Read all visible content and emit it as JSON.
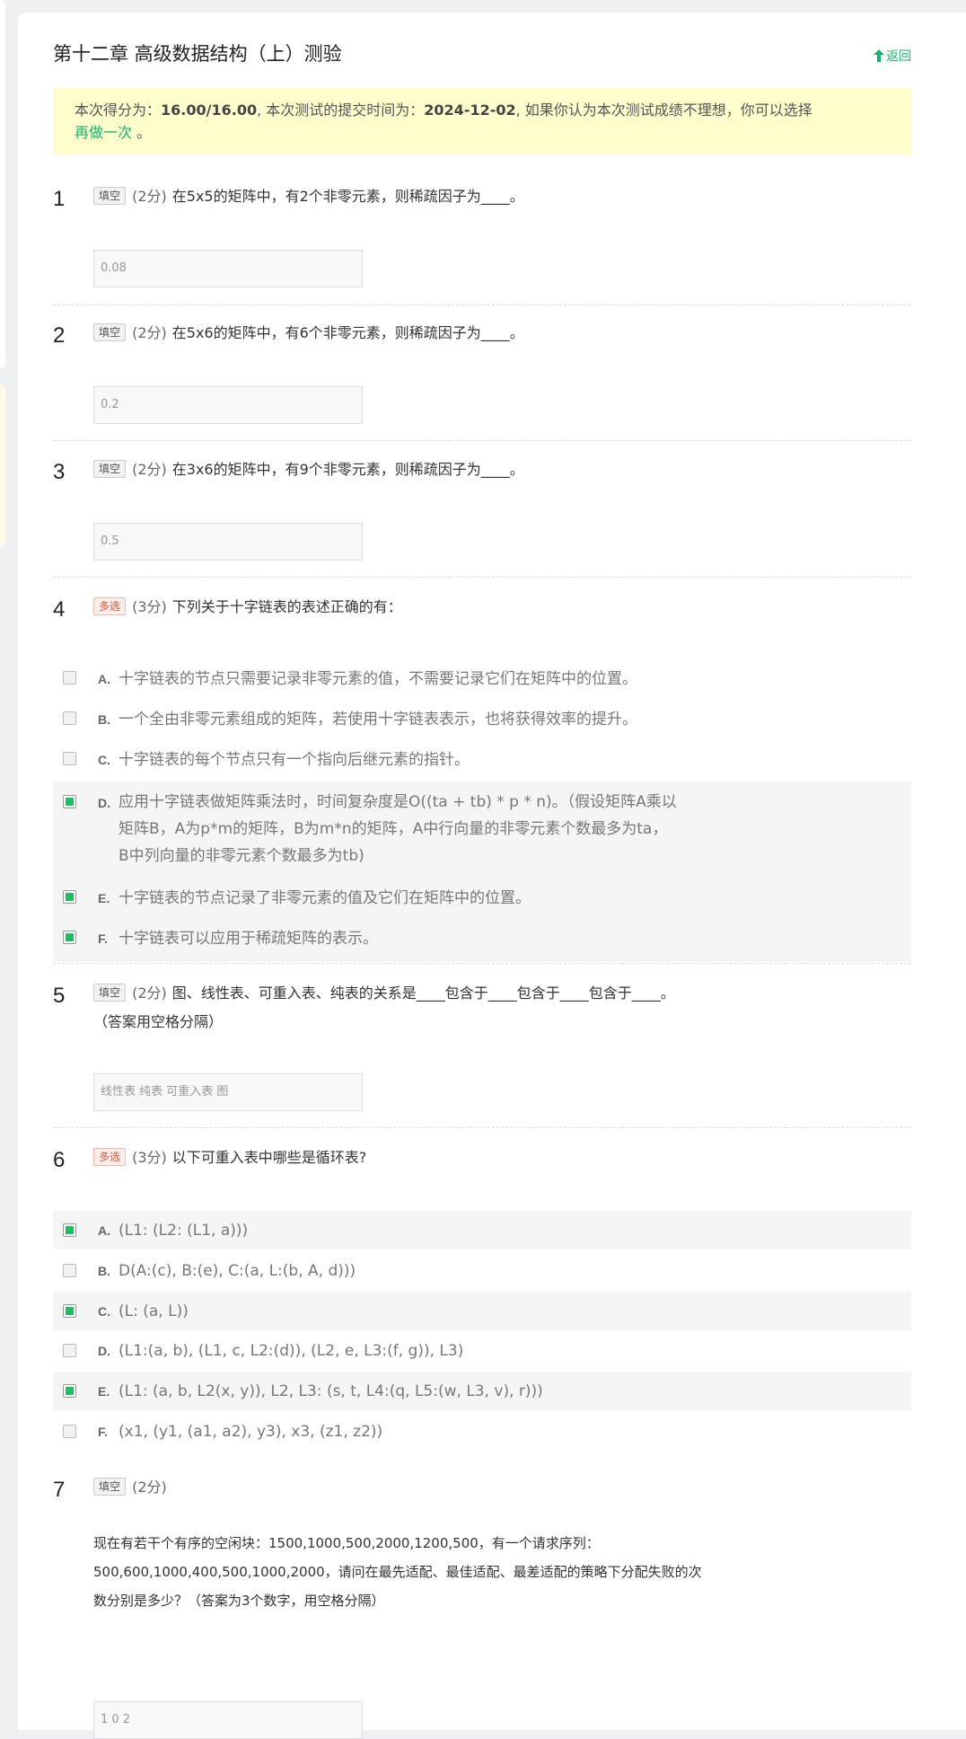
{
  "page": {
    "title": "第十二章 高级数据结构（上）测验",
    "back_label": "返回"
  },
  "notice": {
    "prefix": "本次得分为：",
    "score": "16.00/16.00",
    "mid": ", 本次测试的提交时间为：",
    "date": "2024-12-02",
    "suffix": ", 如果你认为本次测试成绩不理想，你可以选择",
    "redo": "再做一次",
    "end": "。"
  },
  "questions": [
    {
      "num": "1",
      "type": "填空",
      "score": "(2分)",
      "text": "在5x5的矩阵中，有2个非零元素，则稀疏因子为____。",
      "answer": "0.08"
    },
    {
      "num": "2",
      "type": "填空",
      "score": "(2分)",
      "text": "在5x6的矩阵中，有6个非零元素，则稀疏因子为____。",
      "answer": "0.2"
    },
    {
      "num": "3",
      "type": "填空",
      "score": "(2分)",
      "text": "在3x6的矩阵中，有9个非零元素，则稀疏因子为____。",
      "answer": "0.5"
    },
    {
      "num": "4",
      "type": "多选",
      "score": "(3分)",
      "text": "下列关于十字链表的表述正确的有：",
      "options": [
        {
          "letter": "A.",
          "text": "十字链表的节点只需要记录非零元素的值，不需要记录它们在矩阵中的位置。",
          "checked": false
        },
        {
          "letter": "B.",
          "text": "一个全由非零元素组成的矩阵，若使用十字链表表示，也将获得效率的提升。",
          "checked": false
        },
        {
          "letter": "C.",
          "text": "十字链表的每个节点只有一个指向后继元素的指针。",
          "checked": false
        },
        {
          "letter": "D.",
          "text": "应用十字链表做矩阵乘法时，时间复杂度是O((ta + tb) * p * n)。（假设矩阵A乘以矩阵B，A为p*m的矩阵，B为m*n的矩阵，A中行向量的非零元素个数最多为ta，B中列向量的非零元素个数最多为tb)",
          "checked": true
        },
        {
          "letter": "E.",
          "text": "十字链表的节点记录了非零元素的值及它们在矩阵中的位置。",
          "checked": true
        },
        {
          "letter": "F.",
          "text": "十字链表可以应用于稀疏矩阵的表示。",
          "checked": true
        }
      ]
    },
    {
      "num": "5",
      "type": "填空",
      "score": "(2分)",
      "text": "图、线性表、可重入表、纯表的关系是____包含于____包含于____包含于____。（答案用空格分隔）",
      "answer": "线性表 纯表 可重入表 图"
    },
    {
      "num": "6",
      "type": "多选",
      "score": "(3分)",
      "text": "以下可重入表中哪些是循环表?",
      "options": [
        {
          "letter": "A.",
          "text": "(L1: (L2: (L1, a)))",
          "checked": true
        },
        {
          "letter": "B.",
          "text": "D(A:(c), B:(e), C:(a, L:(b, A, d)))",
          "checked": false
        },
        {
          "letter": "C.",
          "text": " (L: (a, L))",
          "checked": true
        },
        {
          "letter": "D.",
          "text": "(L1:(a, b), (L1, c, L2:(d)), (L2, e, L3:(f, g)), L3)",
          "checked": false
        },
        {
          "letter": "E.",
          "text": "(L1: (a, b, L2(x, y)), L2, L3: (s, t, L4:(q, L5:(w, L3, v), r)))",
          "checked": true
        },
        {
          "letter": "F.",
          "text": "(x1, (y1, (a1, a2), y3), x3, (z1, z2))",
          "checked": false
        }
      ]
    },
    {
      "num": "7",
      "type": "填空",
      "score": "(2分)",
      "text": "",
      "stem": "现在有若干个有序的空闲块：1500,1000,500,2000,1200,500，有一个请求序列：500,600,1000,400,500,1000,2000，请问在最先适配、最佳适配、最差适配的策略下分配失败的次数分别是多少？（答案为3个数字，用空格分隔）",
      "answer": "1 0 2"
    }
  ]
}
